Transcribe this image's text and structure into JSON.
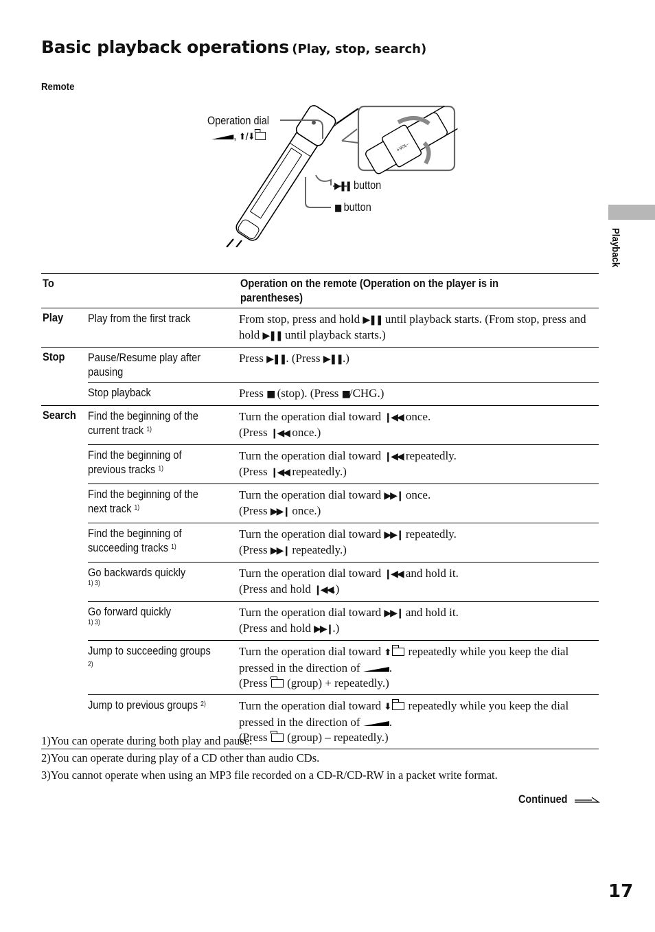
{
  "header": {
    "title": "Basic playback operations",
    "subtitle": "(Play, stop, search)",
    "section": "Remote"
  },
  "illustration": {
    "labels": {
      "operation_dial": "Operation dial",
      "play_pause_button": "button",
      "stop_button": "button"
    },
    "icons": [
      "remote-control-illustration",
      "operation-dial-closeup",
      "play-pause-icon",
      "stop-icon",
      "push-direction-icon",
      "group-up-down-icon"
    ]
  },
  "side_tab": {
    "label": "Playback",
    "color": "#b7b7b7"
  },
  "table": {
    "headers": {
      "to": "To",
      "operation": "Operation on the remote  (Operation on the player is in parentheses)"
    },
    "rows": [
      {
        "category": "Play",
        "task": "Play from the first track",
        "sup": "",
        "op": [
          [
            "From stop, press and hold ",
            "{pp}",
            " until playback starts.  (From stop, press and hold ",
            "{pp}",
            " until playback starts.)"
          ]
        ]
      },
      {
        "category": "Stop",
        "task": "Pause/Resume play after pausing",
        "sup": "",
        "op": [
          [
            "Press ",
            "{pp}",
            ". (Press ",
            "{pp}",
            ".)"
          ]
        ]
      },
      {
        "category": "",
        "task": "Stop playback",
        "sup": "",
        "op": [
          [
            "Press ",
            "{stop}",
            " (stop). (Press ",
            "{stop}",
            "/CHG.)"
          ]
        ]
      },
      {
        "category": "Search",
        "task": "Find the beginning of the current track",
        "sup": "1)",
        "op": [
          [
            "Turn the operation dial toward ",
            "{prev}",
            " once."
          ],
          [
            "(Press ",
            "{prev}",
            " once.)"
          ]
        ]
      },
      {
        "category": "",
        "task": "Find the beginning of previous tracks",
        "sup": "1)",
        "op": [
          [
            "Turn the operation dial toward ",
            "{prev}",
            " repeatedly."
          ],
          [
            "(Press ",
            "{prev}",
            " repeatedly.)"
          ]
        ]
      },
      {
        "category": "",
        "task": "Find the beginning of the next track",
        "sup": "1)",
        "op": [
          [
            "Turn the operation dial toward ",
            "{next}",
            " once."
          ],
          [
            "(Press ",
            "{next}",
            " once.)"
          ]
        ]
      },
      {
        "category": "",
        "task": "Find the beginning of succeeding tracks",
        "sup": "1)",
        "op": [
          [
            "Turn the operation dial toward ",
            "{next}",
            " repeatedly."
          ],
          [
            "(Press ",
            "{next}",
            " repeatedly.)"
          ]
        ]
      },
      {
        "category": "",
        "task": "Go backwards quickly",
        "sup": "1) 3)",
        "supblock": true,
        "op": [
          [
            "Turn the operation dial toward ",
            "{prev}",
            " and hold it."
          ],
          [
            "(Press and hold ",
            "{prev}",
            ".)"
          ]
        ]
      },
      {
        "category": "",
        "task": "Go forward quickly",
        "sup": "1) 3)",
        "supblock": true,
        "op": [
          [
            "Turn the operation dial toward ",
            "{next}",
            " and hold it."
          ],
          [
            "(Press and hold ",
            "{next}",
            ".)"
          ]
        ]
      },
      {
        "category": "",
        "task": "Jump to succeeding groups",
        "sup": "2)",
        "op": [
          [
            "Turn the operation dial toward ",
            "{upfolder}",
            " repeatedly while you keep the dial pressed in the direction of ",
            "{wedge}",
            "."
          ],
          [
            "(Press ",
            "{folder}",
            " (group) + repeatedly.)"
          ]
        ]
      },
      {
        "category": "",
        "task": "Jump to previous groups",
        "sup": "2)",
        "op": [
          [
            "Turn the operation dial toward ",
            "{downfolder}",
            " repeatedly while you keep the dial pressed in the direction of ",
            "{wedge}",
            "."
          ],
          [
            "(Press ",
            "{folder}",
            " (group) – repeatedly.)"
          ]
        ]
      }
    ]
  },
  "footnotes": [
    "1)You can operate during both play and pause.",
    "2)You can operate during play of a CD other than audio CDs.",
    "3)You cannot operate when using an MP3 file recorded on a CD-R/CD-RW in a packet write format."
  ],
  "continued": "Continued",
  "page_number": "17"
}
